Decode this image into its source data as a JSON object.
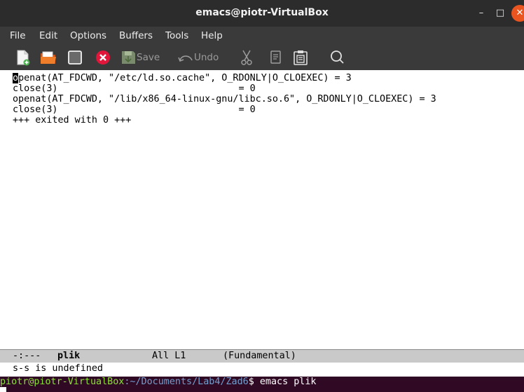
{
  "window": {
    "title": "emacs@piotr-VirtualBox"
  },
  "menubar": {
    "items": [
      "File",
      "Edit",
      "Options",
      "Buffers",
      "Tools",
      "Help"
    ]
  },
  "toolbar": {
    "save_label": "Save",
    "undo_label": "Undo"
  },
  "buffer": {
    "lines": [
      "openat(AT_FDCWD, \"/etc/ld.so.cache\", O_RDONLY|O_CLOEXEC) = 3",
      "close(3)                                = 0",
      "openat(AT_FDCWD, \"/lib/x86_64-linux-gnu/libc.so.6\", O_RDONLY|O_CLOEXEC) = 3",
      "close(3)                                = 0",
      "+++ exited with 0 +++"
    ]
  },
  "modeline": {
    "status": "-:---",
    "buffer_name": "plik",
    "position": "All L1",
    "mode": "(Fundamental)"
  },
  "minibuffer": {
    "message": "s-s is undefined"
  },
  "terminal": {
    "user_host": "piotr@piotr-VirtualBox",
    "path": ":~/Documents/Lab4/Zad6",
    "prompt_cmd": "$ emacs plik"
  },
  "colors": {
    "titlebar": "#2c2c2c",
    "close_button": "#e9541f",
    "terminal_bg": "#300a24",
    "prompt_user": "#8ae234",
    "prompt_path": "#729fcf"
  }
}
